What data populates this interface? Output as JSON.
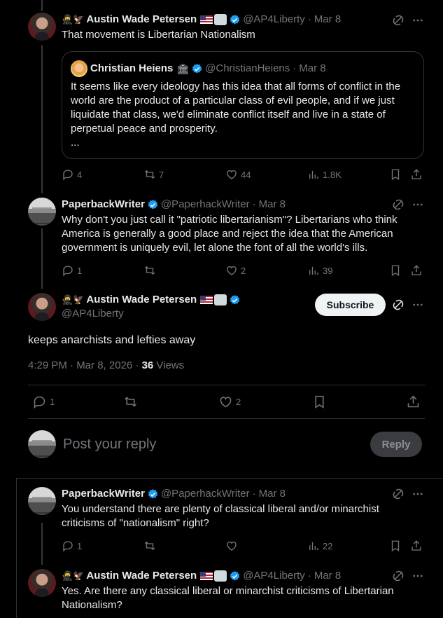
{
  "posts": [
    {
      "emoji": "🥷🦅",
      "name": "Austin Wade Petersen",
      "handle": "@AP4Liberty",
      "separator": "·",
      "date": "Mar 8",
      "text": "That movement is Libertarian Nationalism",
      "quote": {
        "name": "Christian Heiens",
        "handle": "@ChristianHeiens",
        "separator": "·",
        "date": "Mar 8",
        "text": "It seems like every ideology has this idea that all forms of conflict in the world are the product of a particular class of evil people, and if we just liquidate that class, we'd eliminate conflict itself and live in a state of perpetual peace and prosperity.",
        "more": "..."
      },
      "stats": {
        "replies": "4",
        "reposts": "7",
        "likes": "44",
        "views": "1.8K"
      }
    },
    {
      "name": "PaperbackWriter",
      "handle": "@PaperhackWriter",
      "separator": "·",
      "date": "Mar 8",
      "text": "Why don't you just call it \"patriotic libertarianism\"? Libertarians who think America is generally a good place and reject the idea that the American government is uniquely evil, let alone the font of all the world's ills.",
      "stats": {
        "replies": "1",
        "reposts": "",
        "likes": "2",
        "views": "39"
      }
    }
  ],
  "main_post": {
    "emoji": "🥷🦅",
    "name": "Austin Wade Petersen",
    "handle": "@AP4Liberty",
    "subscribe_label": "Subscribe",
    "text": "keeps anarchists and lefties away",
    "timestamp": "4:29 PM · Mar 8, 2026 · ",
    "views_count": "36",
    "views_label": " Views",
    "stats": {
      "replies": "1",
      "reposts": "",
      "likes": "2"
    }
  },
  "reply_box": {
    "placeholder": "Post your reply",
    "button_label": "Reply"
  },
  "replies": [
    {
      "name": "PaperbackWriter",
      "handle": "@PaperhackWriter",
      "separator": "·",
      "date": "Mar 8",
      "text": "You understand there are plenty of classical liberal and/or minarchist criticisms of \"nationalism\" right?",
      "stats": {
        "replies": "1",
        "reposts": "",
        "likes": "",
        "views": "22"
      }
    },
    {
      "emoji": "🥷🦅",
      "name": "Austin Wade Petersen",
      "handle": "@AP4Liberty",
      "separator": "·",
      "date": "Mar 8",
      "text": "Yes. Are there any classical liberal or minarchist criticisms of Libertarian Nationalism?"
    }
  ],
  "colors": {
    "background": "#000000",
    "text": "#e7e9ea",
    "muted": "#71767b",
    "verified": "#1d9bf0",
    "border": "#2f3336"
  }
}
